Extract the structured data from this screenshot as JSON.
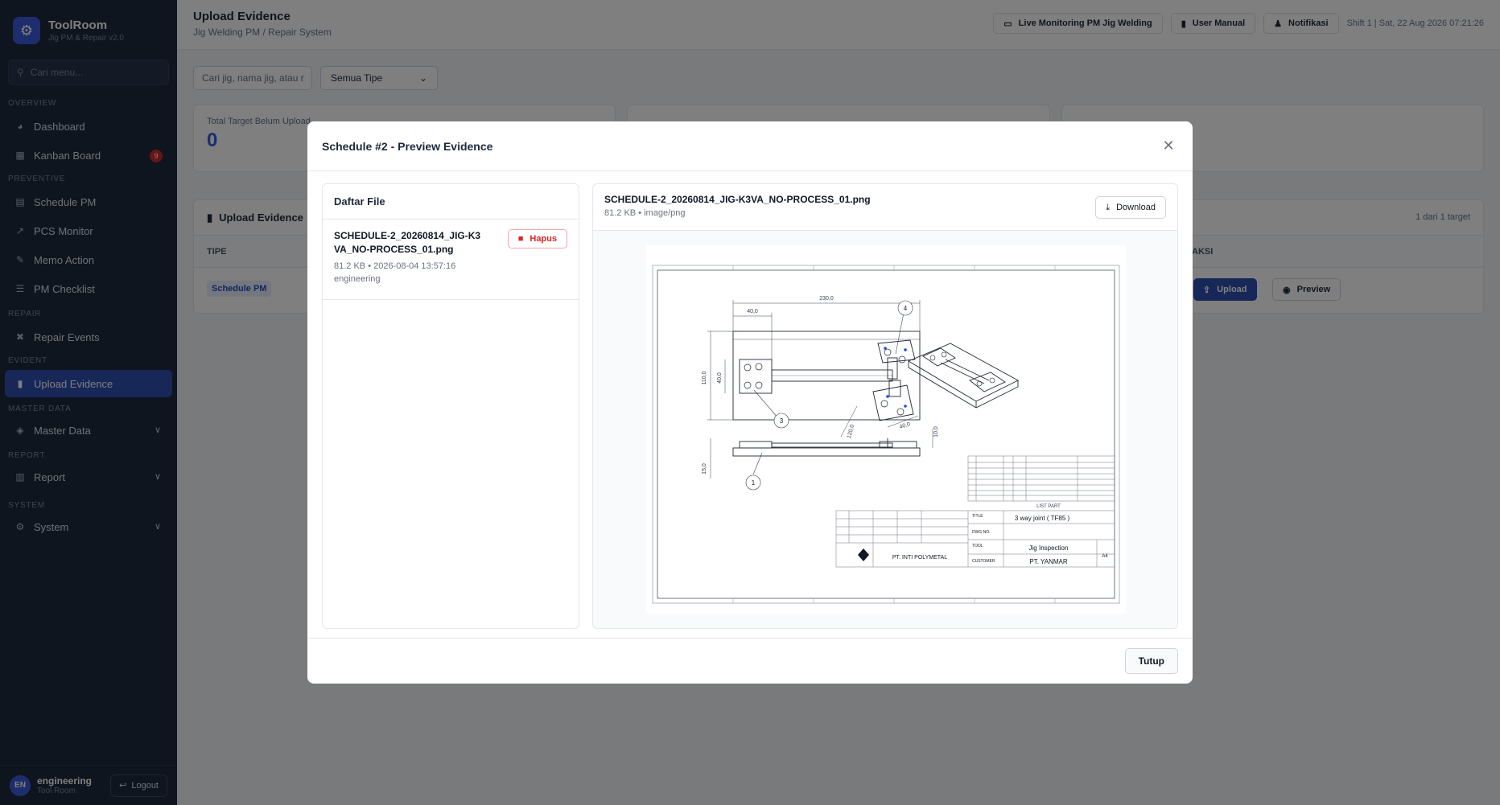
{
  "app": {
    "title": "ToolRoom",
    "subtitle": "Jig PM & Repair v2.0"
  },
  "sidebar": {
    "search_placeholder": "Cari menu...",
    "sections": {
      "overview": "OVERVIEW",
      "preventive": "PREVENTIVE",
      "repair": "REPAIR",
      "evident": "EVIDENT",
      "master": "MASTER DATA",
      "report": "REPORT",
      "system": "SYSTEM"
    },
    "items": {
      "dashboard": "Dashboard",
      "kanban": "Kanban Board",
      "kanban_badge": "9",
      "schedule_pm": "Schedule PM",
      "pcs_monitor": "PCS Monitor",
      "memo_action": "Memo Action",
      "pm_checklist": "PM Checklist",
      "repair_events": "Repair Events",
      "upload_evidence": "Upload Evidence",
      "master_data": "Master Data",
      "report": "Report",
      "system": "System"
    },
    "user": {
      "initials": "EN",
      "name": "engineering",
      "role": "Tool Room",
      "logout_label": "Logout"
    }
  },
  "header": {
    "title": "Upload Evidence",
    "subtitle": "Jig Welding PM / Repair System",
    "live_label": "Live Monitoring PM Jig Welding",
    "manual_label": "User Manual",
    "notif_label": "Notifikasi",
    "shift_text": "Shift 1 | Sat, 22 Aug 2026 07:21:26"
  },
  "filters": {
    "search_placeholder": "Cari jig, nama jig, atau r",
    "type_selected": "Semua Tipe"
  },
  "stats": [
    {
      "label": "Total Target Belum Upload",
      "value": "0"
    }
  ],
  "table": {
    "title": "Upload Evidence",
    "count_text": "1 dari 1 target",
    "col_type": "TIPE",
    "col_action": "AKSI",
    "rows": [
      {
        "type": "Schedule PM",
        "upload_label": "Upload",
        "preview_label": "Preview"
      }
    ]
  },
  "modal": {
    "title": "Schedule #2 - Preview Evidence",
    "file_list_title": "Daftar File",
    "files": [
      {
        "name": "SCHEDULE-2_20260814_JIG-K3VA_NO-PROCESS_01.png",
        "meta": "81.2 KB • 2026-08-04 13:57:16",
        "user": "engineering",
        "delete_label": "Hapus"
      }
    ],
    "preview": {
      "file_name": "SCHEDULE-2_20260814_JIG-K3VA_NO-PROCESS_01.png",
      "file_meta": "81.2 KB • image/png",
      "download_label": "Download"
    },
    "drawing": {
      "dims": {
        "d230": "230,0",
        "d40": "40,0",
        "d110": "110,0",
        "d40v": "40,0",
        "d40b": "40,0",
        "d120": "120,0",
        "d10": "10,0",
        "d15": "15,0"
      },
      "balloons": [
        "1",
        "3",
        "4"
      ],
      "title_block": {
        "list_part": "LIST PART",
        "title_label": "TITLE",
        "title_value": "3 way joint ( TF85 )",
        "dwg_label": "DWG NO.",
        "tool_label": "TOOL",
        "tool_value": "Jig Inspection",
        "customer_label": "CUSTOMER",
        "customer_value": "PT. YANMAR",
        "company": "PT. INTI POLYMETAL",
        "size": "A4"
      }
    },
    "close_label": "Tutup"
  },
  "colors": {
    "accent": "#2c4fb0",
    "sidebar_bg": "#1e2a3d",
    "danger": "#dc2626"
  }
}
